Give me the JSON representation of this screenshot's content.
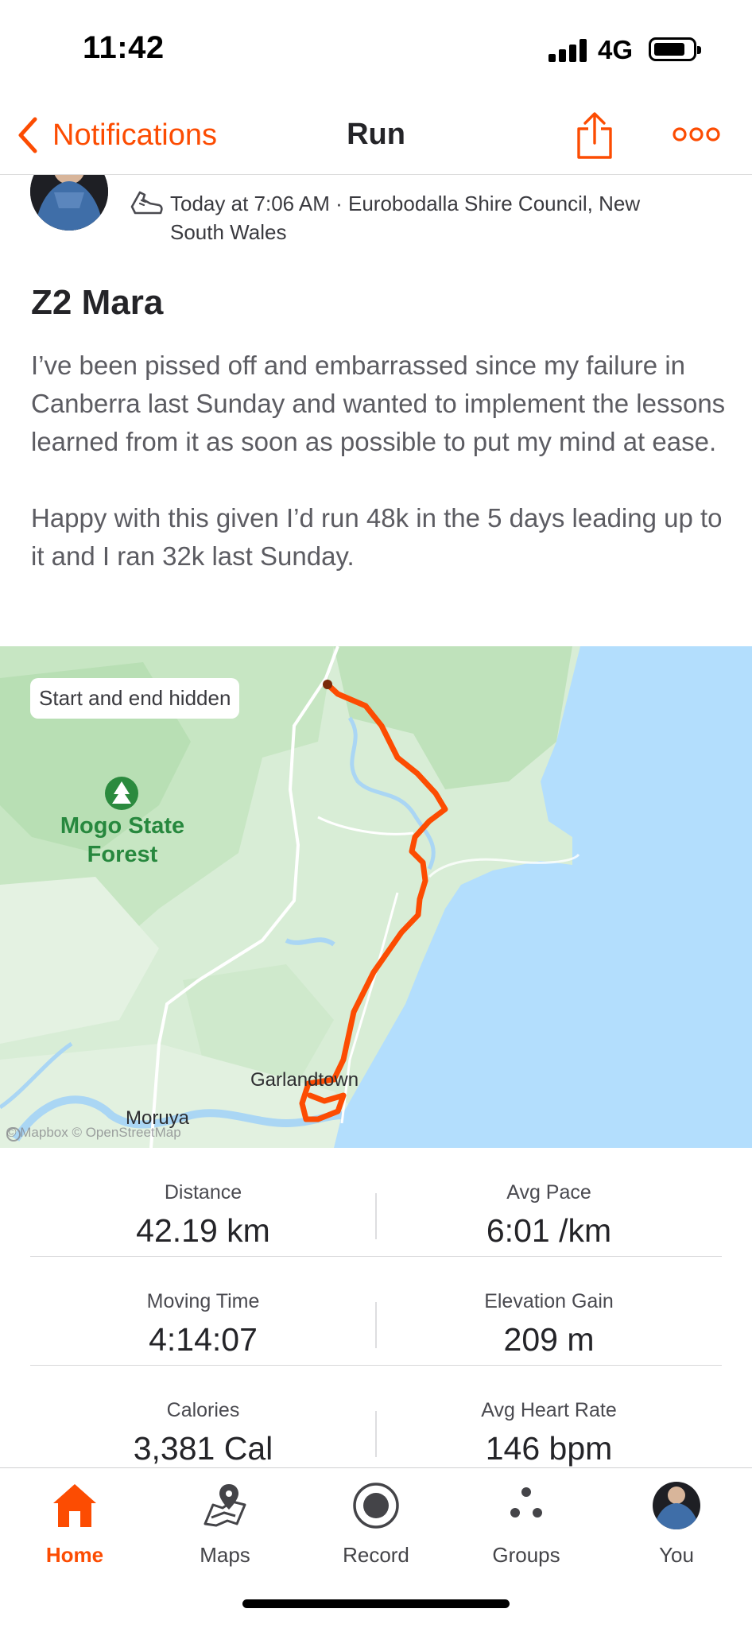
{
  "status_bar": {
    "time": "11:42",
    "network": "4G"
  },
  "nav": {
    "back_label": "Notifications",
    "title": "Run"
  },
  "activity": {
    "meta": "Today at 7:06 AM · Eurobodalla Shire Council, New South Wales",
    "title": "Z2 Mara",
    "description": [
      "I’ve been pissed off and embarrassed since my failure in Canberra last Sunday and wanted to implement the lessons learned from it as soon as possible to put my mind at ease.",
      "Happy with this given I’d run 48k in the 5 days leading up to it and I ran 32k last Sunday."
    ]
  },
  "map": {
    "chip": "Start and end hidden",
    "forest_label": "Mogo State Forest",
    "town_1": "Garlandtown",
    "town_2": "Moruya",
    "attribution": "© Mapbox © OpenStreetMap",
    "route_color": "#fc4c02",
    "water_color": "#b3defd",
    "land_color": "#d8edd6"
  },
  "stats": [
    {
      "left_label": "Distance",
      "left_value": "42.19 km",
      "right_label": "Avg Pace",
      "right_value": "6:01 /km"
    },
    {
      "left_label": "Moving Time",
      "left_value": "4:14:07",
      "right_label": "Elevation Gain",
      "right_value": "209 m"
    },
    {
      "left_label": "Calories",
      "left_value": "3,381 Cal",
      "right_label": "Avg Heart Rate",
      "right_value": "146 bpm"
    }
  ],
  "tabs": [
    {
      "label": "Home",
      "icon": "home-icon"
    },
    {
      "label": "Maps",
      "icon": "maps-icon"
    },
    {
      "label": "Record",
      "icon": "record-icon"
    },
    {
      "label": "Groups",
      "icon": "groups-icon"
    },
    {
      "label": "You",
      "icon": "avatar"
    }
  ],
  "accent_color": "#fc4c02"
}
